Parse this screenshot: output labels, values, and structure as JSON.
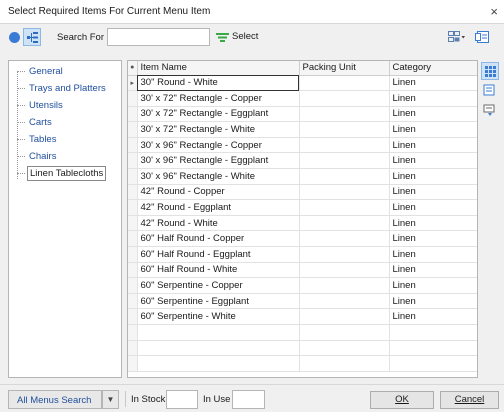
{
  "window": {
    "title": "Select Required Items  For Current Menu Item",
    "close_glyph": "×"
  },
  "toolbar": {
    "search_label": "Search For",
    "search_value": "",
    "select_label": "Select"
  },
  "tree": {
    "items": [
      {
        "label": "General"
      },
      {
        "label": "Trays and Platters"
      },
      {
        "label": "Utensils"
      },
      {
        "label": "Carts"
      },
      {
        "label": "Tables"
      },
      {
        "label": "Chairs"
      },
      {
        "label": "Linen Tablecloths",
        "selected": true
      }
    ]
  },
  "grid": {
    "columns": [
      "Item Name",
      "Packing Unit",
      "Category"
    ],
    "rows": [
      {
        "name": "30\" Round - White",
        "packing": "",
        "category": "Linen",
        "current": true
      },
      {
        "name": "30' x 72\" Rectangle - Copper",
        "packing": "",
        "category": "Linen"
      },
      {
        "name": "30' x 72\" Rectangle - Eggplant",
        "packing": "",
        "category": "Linen"
      },
      {
        "name": "30' x 72\" Rectangle - White",
        "packing": "",
        "category": "Linen"
      },
      {
        "name": "30' x 96\" Rectangle - Copper",
        "packing": "",
        "category": "Linen"
      },
      {
        "name": "30' x 96\" Rectangle - Eggplant",
        "packing": "",
        "category": "Linen"
      },
      {
        "name": "30' x 96\" Rectangle - White",
        "packing": "",
        "category": "Linen"
      },
      {
        "name": "42\" Round - Copper",
        "packing": "",
        "category": "Linen"
      },
      {
        "name": "42\" Round - Eggplant",
        "packing": "",
        "category": "Linen"
      },
      {
        "name": "42\" Round - White",
        "packing": "",
        "category": "Linen"
      },
      {
        "name": "60\" Half Round - Copper",
        "packing": "",
        "category": "Linen"
      },
      {
        "name": "60\" Half Round - Eggplant",
        "packing": "",
        "category": "Linen"
      },
      {
        "name": "60\" Half Round - White",
        "packing": "",
        "category": "Linen"
      },
      {
        "name": "60\" Serpentine - Copper",
        "packing": "",
        "category": "Linen"
      },
      {
        "name": "60\" Serpentine - Eggplant",
        "packing": "",
        "category": "Linen"
      },
      {
        "name": "60\" Serpentine - White",
        "packing": "",
        "category": "Linen"
      }
    ]
  },
  "bottom": {
    "all_menus_label": "All Menus Search",
    "dropdown_glyph": "▼",
    "in_stock_label": "In Stock",
    "in_stock_value": "",
    "in_use_label": "In Use",
    "in_use_value": "",
    "ok_label": "OK",
    "cancel_label": "Cancel"
  },
  "colors": {
    "accent": "#3a7bd5",
    "link": "#1f4e9c",
    "selection_bg": "#cfe3f7"
  }
}
